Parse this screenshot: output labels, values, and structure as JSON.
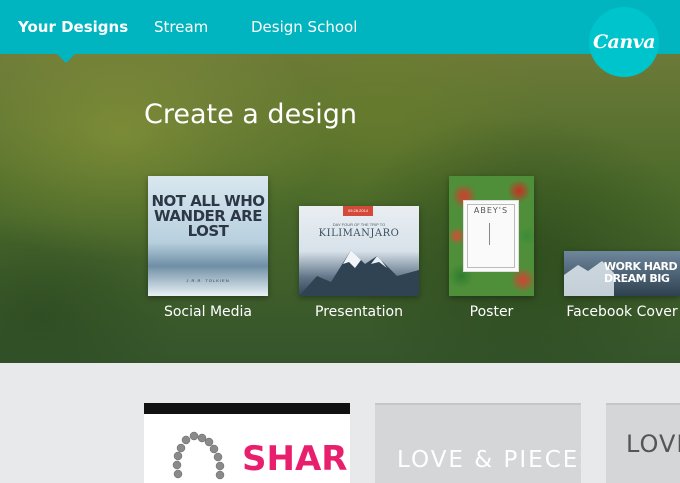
{
  "nav": {
    "items": [
      {
        "label": "Your Designs",
        "active": true
      },
      {
        "label": "Stream",
        "active": false
      },
      {
        "label": "Design School",
        "active": false
      }
    ],
    "logo_text": "Canva",
    "accent_color": "#00b5bf"
  },
  "hero": {
    "title": "Create a design",
    "templates": [
      {
        "label": "Social Media",
        "thumb_text": "NOT ALL WHO WANDER ARE LOST",
        "thumb_subtext": "J.R.R. TOLKIEN"
      },
      {
        "label": "Presentation",
        "thumb_badge": "09.28.2014",
        "thumb_subtext": "DAY FOUR OF THE TRIP TO",
        "thumb_text": "KILIMANJARO"
      },
      {
        "label": "Poster",
        "thumb_text": "ABEY'S"
      },
      {
        "label": "Facebook Cover",
        "thumb_text": "WORK HARD DREAM BIG"
      }
    ]
  },
  "designs": [
    {
      "text": "SHARK"
    },
    {
      "text": "LOVE & PIECES"
    },
    {
      "text": "LOVE"
    }
  ]
}
